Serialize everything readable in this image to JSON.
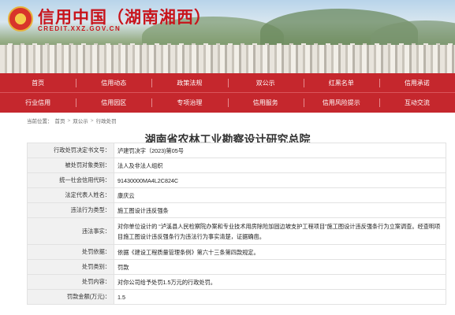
{
  "header": {
    "site_title": "信用中国（湖南湘西）",
    "site_subtitle": "CREDIT.XXZ.GOV.CN"
  },
  "nav": {
    "row1": [
      "首页",
      "信用动态",
      "政策法规",
      "双公示",
      "红黑名单",
      "信用承诺"
    ],
    "row2": [
      "行业信用",
      "信用园区",
      "专项治理",
      "信用服务",
      "信用风险提示",
      "互动交流"
    ]
  },
  "breadcrumb": {
    "label": "当前位置：",
    "items": [
      "首页",
      "双公示",
      "行政处罚"
    ],
    "separator": ">"
  },
  "page_title": "湖南省农林工业勘察设计研究总院",
  "record": [
    {
      "key": "行政处罚决定书文号：",
      "value": "泸建罚决字（2023)第05号"
    },
    {
      "key": "被处罚对象类别：",
      "value": "法人及非法人组织"
    },
    {
      "key": "统一社会信用代码：",
      "value": "91430000MA4L2C824C"
    },
    {
      "key": "法定代表人姓名：",
      "value": "康庆云"
    },
    {
      "key": "违法行为类型：",
      "value": "施工图设计违反强条"
    },
    {
      "key": "违法事实：",
      "value": "对你单位设计的 “泸溪县人民检察院办案和专业技术用房除险加固边坡支护工程项目”施工图设计违反强条行为立案调查。经查明项目施工图设计违反强条行为违法行为事实清楚，证据确凿。"
    },
    {
      "key": "处罚依据：",
      "value": "依据《建设工程质量管理条例》第六十三条第四款规定。"
    },
    {
      "key": "处罚类别：",
      "value": "罚款"
    },
    {
      "key": "处罚内容：",
      "value": "对你公司给予处罚1.5万元的行政处罚。"
    },
    {
      "key": "罚款金额(万元)：",
      "value": "1.5"
    }
  ]
}
